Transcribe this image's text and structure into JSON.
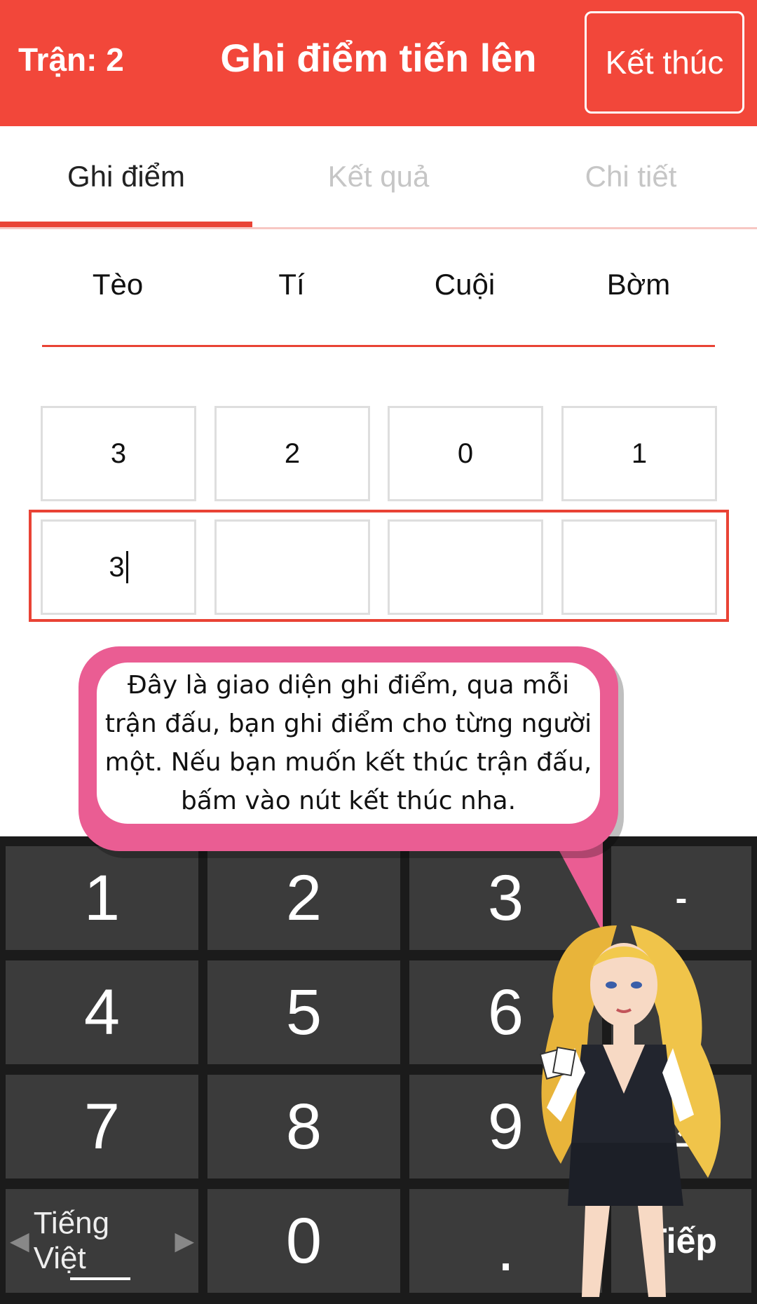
{
  "header": {
    "round_label": "Trận: 2",
    "title": "Ghi điểm tiến lên",
    "end_button": "Kết thúc"
  },
  "tabs": [
    {
      "label": "Ghi điểm",
      "active": true
    },
    {
      "label": "Kết quả",
      "active": false
    },
    {
      "label": "Chi tiết",
      "active": false
    }
  ],
  "players": [
    "Tèo",
    "Tí",
    "Cuội",
    "Bờm"
  ],
  "score_rows": [
    [
      "3",
      "2",
      "0",
      "1"
    ],
    [
      "3",
      "",
      "",
      ""
    ]
  ],
  "tip_text": "Đây là giao diện ghi điểm, qua mỗi trận đấu, bạn ghi điểm cho từng người một. Nếu bạn muốn kết thúc trận đấu, bấm vào nút kết thúc nha.",
  "keyboard": {
    "row1": [
      "1",
      "2",
      "3",
      "-"
    ],
    "row2": [
      "4",
      "5",
      "6"
    ],
    "row3": [
      "7",
      "8",
      "9"
    ],
    "language": "Tiếng Việt",
    "zero": "0",
    "dot": ".",
    "next": "Tiếp"
  },
  "colors": {
    "accent": "#f2473a",
    "bubble": "#ea5d93",
    "keyboard_bg": "#1b1b1b",
    "key_bg": "#3b3b3b"
  }
}
